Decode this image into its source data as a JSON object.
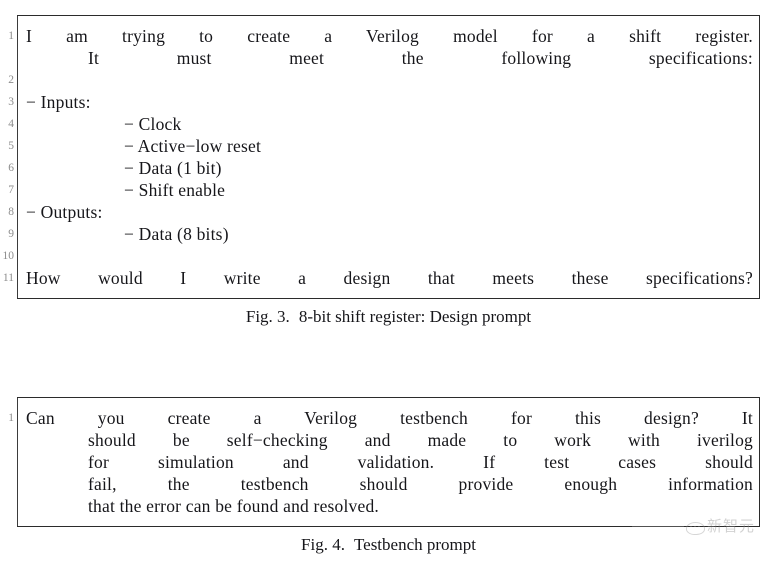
{
  "document": {
    "background_color": "#ffffff",
    "text_color": "#16161a",
    "rule_color": "#2b2b2b",
    "lineno_color": "#8d8d8d"
  },
  "figures": [
    {
      "id": "design-prompt",
      "listing": {
        "line_numbers": [
          "1",
          "2",
          "3",
          "4",
          "5",
          "6",
          "7",
          "8",
          "9",
          "10",
          "11"
        ],
        "lines": [
          {
            "n": "1",
            "text": "I am trying to create a Verilog model for a shift register.",
            "style": "justified"
          },
          {
            "n": "",
            "text": "It must meet the following specifications:",
            "style": "justified-indented"
          },
          {
            "n": "2",
            "text": "",
            "style": "blank"
          },
          {
            "n": "3",
            "text": "− Inputs:",
            "style": "plain"
          },
          {
            "n": "4",
            "text": "− Clock",
            "style": "indent2"
          },
          {
            "n": "5",
            "text": "− Active−low reset",
            "style": "indent2"
          },
          {
            "n": "6",
            "text": "− Data (1 bit)",
            "style": "indent2"
          },
          {
            "n": "7",
            "text": "− Shift enable",
            "style": "indent2"
          },
          {
            "n": "8",
            "text": "− Outputs:",
            "style": "plain"
          },
          {
            "n": "9",
            "text": "− Data (8 bits)",
            "style": "indent2"
          },
          {
            "n": "10",
            "text": "",
            "style": "blank"
          },
          {
            "n": "11",
            "text": "How would I write a design that meets these specifications?",
            "style": "justified"
          }
        ]
      },
      "caption": {
        "label": "Fig. 3.",
        "text": "8-bit shift register: Design prompt"
      }
    },
    {
      "id": "testbench-prompt",
      "listing": {
        "line_numbers": [
          "1"
        ],
        "lines": [
          {
            "n": "1",
            "text": "Can you create a Verilog testbench for this design? It",
            "style": "justified"
          },
          {
            "n": "",
            "text": "should be self−checking and made to work with iverilog",
            "style": "justified-indented"
          },
          {
            "n": "",
            "text": "for simulation and validation. If test cases should",
            "style": "justified-indented"
          },
          {
            "n": "",
            "text": "fail, the testbench should provide enough information",
            "style": "justified-indented"
          },
          {
            "n": "",
            "text": "that the error can be found and resolved.",
            "style": "indented-last"
          }
        ]
      },
      "caption": {
        "label": "Fig. 4.",
        "text": "Testbench prompt"
      }
    }
  ],
  "watermark": {
    "text": "新智元",
    "logo_name": "speech-bubble-logo",
    "color": "#8e8e8e"
  }
}
